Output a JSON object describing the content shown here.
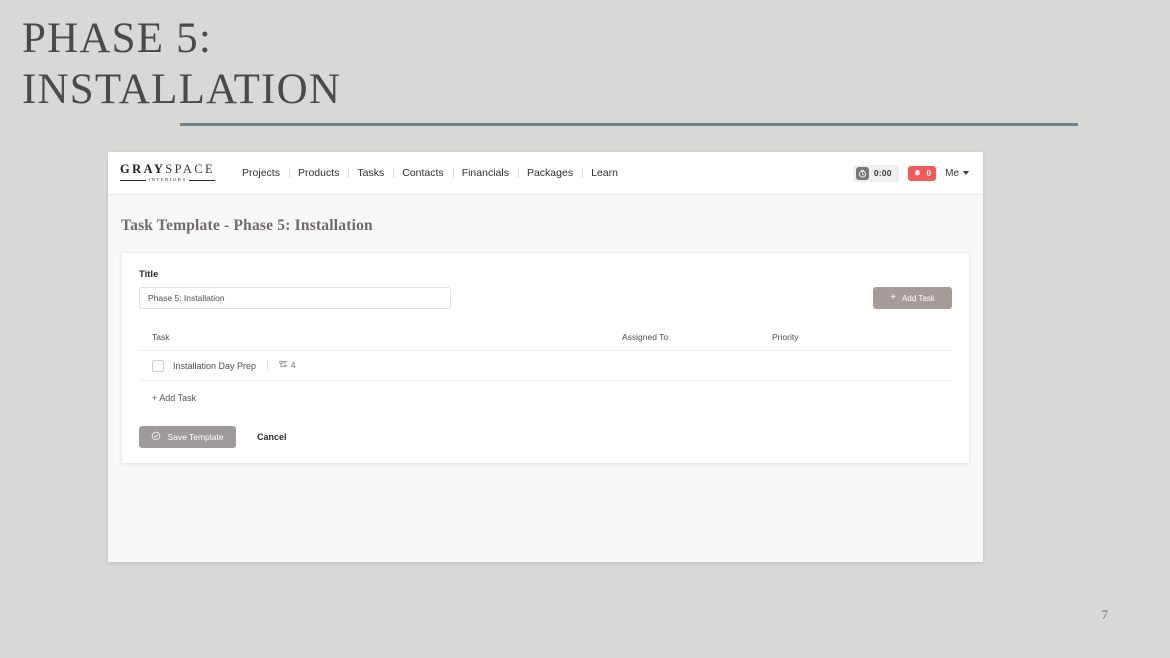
{
  "slide": {
    "title": "PHASE 5:\nINSTALLATION",
    "number": "7"
  },
  "app": {
    "logo": {
      "gray": "GRAY",
      "space": "SPACE",
      "sub": "INTERIORS"
    },
    "nav": [
      {
        "label": "Projects"
      },
      {
        "label": "Products"
      },
      {
        "label": "Tasks"
      },
      {
        "label": "Contacts"
      },
      {
        "label": "Financials"
      },
      {
        "label": "Packages"
      },
      {
        "label": "Learn"
      }
    ],
    "header_right": {
      "timer_value": "0:00",
      "timer_icon": "stopwatch-icon",
      "notifications_count": "0",
      "notifications_icon": "bell-icon",
      "user_label": "Me",
      "caret_icon": "chevron-down-icon"
    }
  },
  "page": {
    "title": "Task Template - Phase 5: Installation"
  },
  "form": {
    "title_label": "Title",
    "title_value": "Phase 5: Installation",
    "title_placeholder": "Title",
    "add_task_button": "Add Task",
    "add_task_icon": "plus-icon"
  },
  "table": {
    "columns": {
      "task": "Task",
      "assigned_to": "Assigned To",
      "priority": "Priority"
    },
    "rows": [
      {
        "checked": false,
        "task": "Installation Day Prep",
        "subtask_icon": "subtask-list-icon",
        "subtask_count": "4",
        "assigned_to": "",
        "priority": ""
      }
    ],
    "add_task_link": "+ Add Task"
  },
  "actions": {
    "save_label": "Save Template",
    "save_icon": "check-circle-icon",
    "cancel_label": "Cancel"
  },
  "colors": {
    "slide_background": "#d8d8d6",
    "accent_rule": "#6d8389",
    "button_taupe": "#a59c9a",
    "notification_red": "#f4595c",
    "page_title": "#6f6a6a"
  }
}
